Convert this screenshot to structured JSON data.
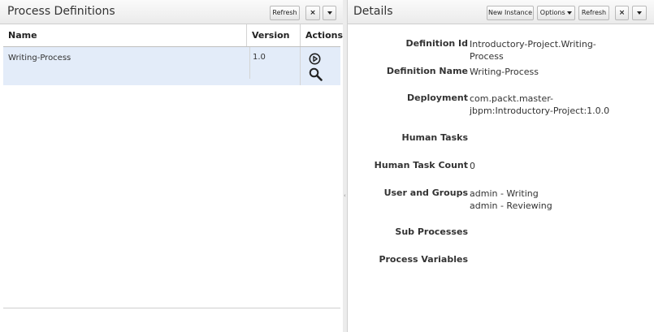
{
  "left": {
    "title": "Process Definitions",
    "refresh_label": "Refresh",
    "close_label": "×",
    "columns": {
      "name": "Name",
      "version": "Version",
      "actions": "Actions"
    },
    "rows": [
      {
        "name": "Writing-Process",
        "version": "1.0",
        "action_icons": [
          "start-process-icon",
          "search-icon"
        ]
      }
    ]
  },
  "right": {
    "title": "Details",
    "new_instance_label": "New Instance",
    "options_label": "Options",
    "refresh_label": "Refresh",
    "close_label": "×",
    "fields": [
      {
        "label": "Definition Id",
        "value": "Introductory-Project.Writing-Process"
      },
      {
        "label": "Definition Name",
        "value": "Writing-Process"
      },
      {
        "label": "Deployment",
        "value": "com.packt.master-jbpm:Introductory-Project:1.0.0"
      },
      {
        "label": "Human Tasks",
        "value": ""
      },
      {
        "label": "Human Task Count",
        "value": "0"
      },
      {
        "label": "User and Groups",
        "value": "admin - Writing",
        "value2": "admin - Reviewing"
      },
      {
        "label": "Sub Processes",
        "value": ""
      },
      {
        "label": "Process Variables",
        "value": ""
      }
    ]
  },
  "colors": {
    "selected_row": "#e3ecf9",
    "border": "#cfcfcf"
  }
}
